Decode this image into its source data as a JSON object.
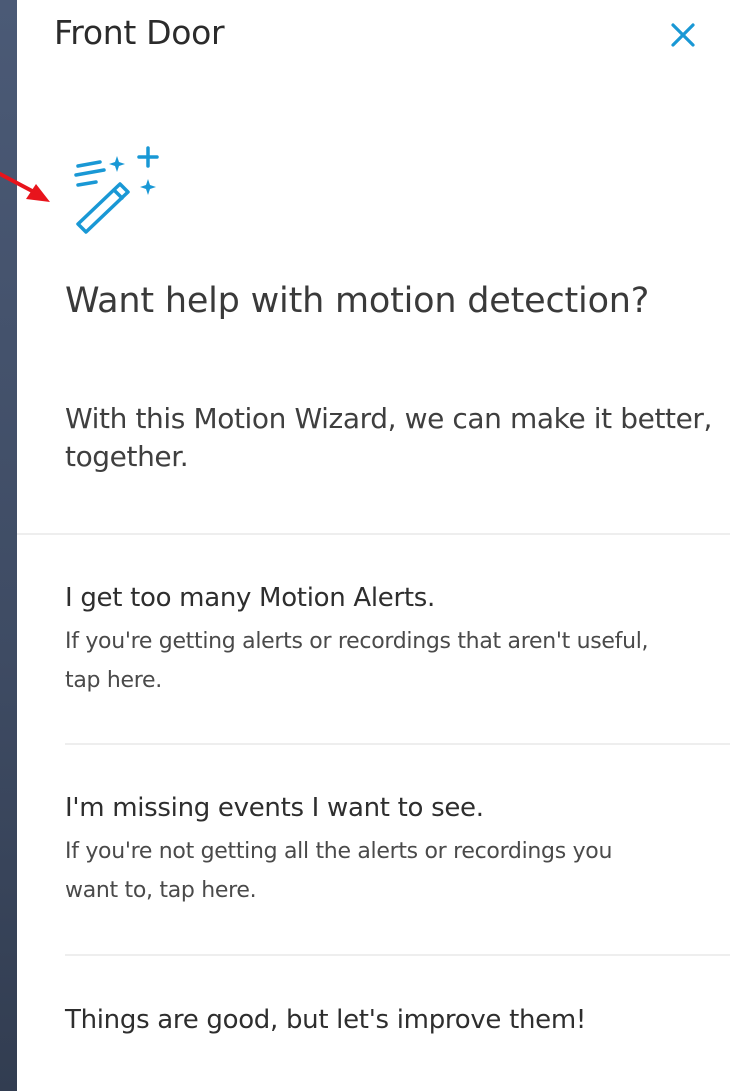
{
  "header": {
    "title": "Front Door"
  },
  "wizard": {
    "heading": "Want help with motion detection?",
    "subheading": "With this Motion Wizard, we can make it better, together."
  },
  "options": [
    {
      "title": "I get too many Motion Alerts.",
      "description": "If you're getting alerts or recordings that aren't useful, tap here."
    },
    {
      "title": "I'm missing events I want to see.",
      "description": "If you're not getting all the alerts or recordings you want to, tap here."
    },
    {
      "title": "Things are good, but let's improve them!",
      "description": ""
    }
  ],
  "icons": {
    "close": "close-icon",
    "wand": "magic-wand-icon",
    "arrow": "arrow-annotation-icon"
  },
  "colors": {
    "accent": "#1998d5",
    "arrow": "#e8141c",
    "background": "#3d4960"
  }
}
